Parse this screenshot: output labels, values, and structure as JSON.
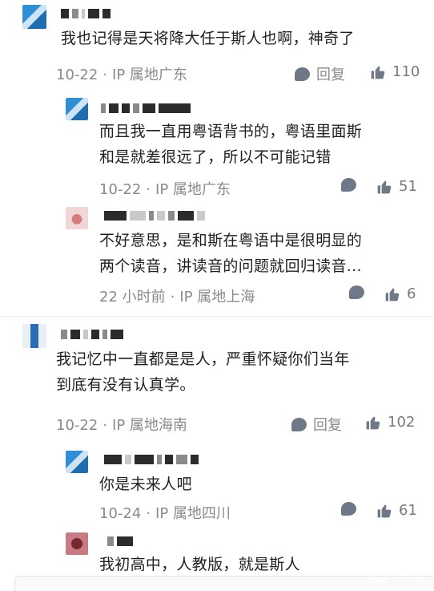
{
  "comments": [
    {
      "text_lines": [
        "我也记得是天将降大任于斯人也啊，神奇了"
      ],
      "date": "10-22",
      "sep": "·",
      "location": "IP 属地广东",
      "reply_label": "回复",
      "likes": "110"
    },
    {
      "text_lines": [
        "而且我一直用粤语背书的，粤语里面斯",
        "和是就差很远了，所以不可能记错"
      ],
      "date": "10-22",
      "sep": "·",
      "location": "IP 属地广东",
      "likes": "51"
    },
    {
      "text_lines": [
        "不好意思，是和斯在粤语中是很明显的",
        "两个读音，讲读音的问题就回归读音..."
      ],
      "date": "22 小时前",
      "sep": "·",
      "location": "IP 属地上海",
      "likes": "6"
    },
    {
      "text_lines": [
        "我记忆中一直都是是人，严重怀疑你们当年",
        "到底有没有认真学。"
      ],
      "date": "10-22",
      "sep": "·",
      "location": "IP 属地海南",
      "reply_label": "回复",
      "likes": "102"
    },
    {
      "text_lines": [
        "你是未来人吧"
      ],
      "date": "10-24",
      "sep": "·",
      "location": "IP 属地四川",
      "likes": "61"
    },
    {
      "text_lines": [
        "我初高中，人教版，就是斯人"
      ]
    }
  ],
  "watermark": {
    "text": "小黑盒"
  },
  "icons": {
    "reply": "speech-bubble-icon",
    "like": "thumbs-up-icon"
  },
  "colors": {
    "text": "#1f1f1f",
    "meta": "#8a8a8a",
    "icon": "#6e7887"
  }
}
